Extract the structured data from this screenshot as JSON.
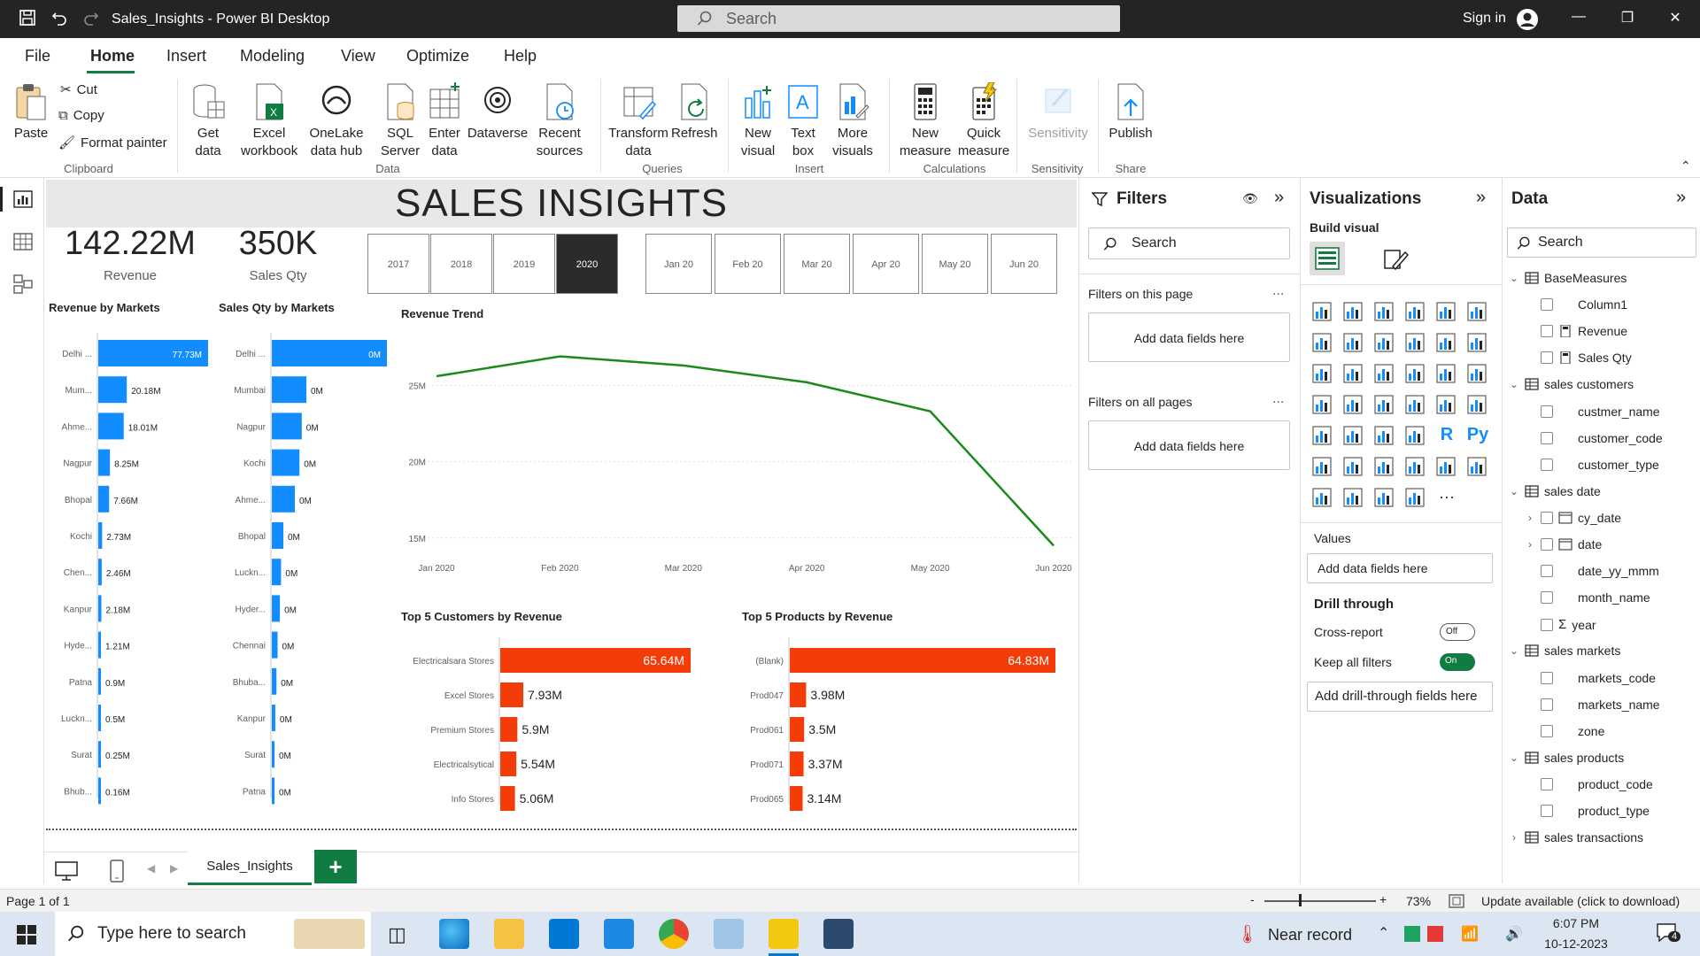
{
  "window": {
    "title": "Sales_Insights - Power BI Desktop",
    "search_placeholder": "Search",
    "sign_in": "Sign in"
  },
  "menu": [
    "File",
    "Home",
    "Insert",
    "Modeling",
    "View",
    "Optimize",
    "Help"
  ],
  "ribbon": {
    "paste": "Paste",
    "cut": "Cut",
    "copy": "Copy",
    "format_painter": "Format painter",
    "clipboard": "Clipboard",
    "get_data": "Get data",
    "excel": "Excel workbook",
    "onelake": "OneLake data hub",
    "sql": "SQL Server",
    "enter_data": "Enter data",
    "dataverse": "Dataverse",
    "recent": "Recent sources",
    "data_group": "Data",
    "transform": "Transform data",
    "refresh": "Refresh",
    "queries": "Queries",
    "new_visual": "New visual",
    "text_box": "Text box",
    "more_visuals": "More visuals",
    "insert": "Insert",
    "new_measure": "New measure",
    "quick_measure": "Quick measure",
    "calculations": "Calculations",
    "sensitivity": "Sensitivity",
    "sensitivity_group": "Sensitivity",
    "publish": "Publish",
    "share": "Share"
  },
  "report": {
    "title": "SALES INSIGHTS",
    "kpis": [
      {
        "value": "142.22M",
        "label": "Revenue"
      },
      {
        "value": "350K",
        "label": "Sales Qty"
      }
    ],
    "year_slicer": [
      "2017",
      "2018",
      "2019",
      "2020"
    ],
    "year_selected": "2020",
    "month_slicer": [
      "Jan 20",
      "Feb 20",
      "Mar 20",
      "Apr 20",
      "May 20",
      "Jun 20"
    ]
  },
  "chart_data": [
    {
      "type": "bar",
      "title": "Revenue by Markets",
      "categories": [
        "Delhi ...",
        "Mum...",
        "Ahme...",
        "Nagpur",
        "Bhopal",
        "Kochi",
        "Chen...",
        "Kanpur",
        "Hyde...",
        "Patna",
        "Luckn...",
        "Surat",
        "Bhub..."
      ],
      "values": [
        77.73,
        20.18,
        18.01,
        8.25,
        7.66,
        2.73,
        2.46,
        2.18,
        1.21,
        0.9,
        0.5,
        0.25,
        0.16
      ],
      "labels": [
        "77.73M",
        "20.18M",
        "18.01M",
        "8.25M",
        "7.66M",
        "2.73M",
        "2.46M",
        "2.18M",
        "1.21M",
        "0.9M",
        "0.5M",
        "0.25M",
        "0.16M"
      ],
      "color": "#118dff"
    },
    {
      "type": "bar",
      "title": "Sales Qty by Markets",
      "categories": [
        "Delhi ...",
        "Mumbai",
        "Nagpur",
        "Kochi",
        "Ahme...",
        "Bhopal",
        "Luckn...",
        "Hyder...",
        "Chennai",
        "Bhuba...",
        "Kanpur",
        "Surat",
        "Patna"
      ],
      "values": [
        100,
        30,
        26,
        24,
        20,
        10,
        8,
        7,
        5,
        4,
        3,
        2,
        1.5
      ],
      "labels": [
        "0M",
        "0M",
        "0M",
        "0M",
        "0M",
        "0M",
        "0M",
        "0M",
        "0M",
        "0M",
        "0M",
        "0M",
        "0M"
      ],
      "color": "#118dff"
    },
    {
      "type": "line",
      "title": "Revenue Trend",
      "x": [
        "Jan 2020",
        "Feb 2020",
        "Mar 2020",
        "Apr 2020",
        "May 2020",
        "Jun 2020"
      ],
      "values": [
        25.6,
        26.9,
        26.3,
        25.2,
        23.3,
        14.5
      ],
      "yticks": [
        "15M",
        "20M",
        "25M"
      ],
      "ylim": [
        14,
        28.5
      ],
      "color": "#1a8a1a"
    },
    {
      "type": "bar",
      "title": "Top 5 Customers by Revenue",
      "categories": [
        "Electricalsara Stores",
        "Excel Stores",
        "Premium Stores",
        "Electricalsytical",
        "Info Stores"
      ],
      "values": [
        65.64,
        7.93,
        5.9,
        5.54,
        5.06
      ],
      "labels": [
        "65.64M",
        "7.93M",
        "5.9M",
        "5.54M",
        "5.06M"
      ],
      "color": "#f43c09"
    },
    {
      "type": "bar",
      "title": "Top 5 Products by Revenue",
      "categories": [
        "(Blank)",
        "Prod047",
        "Prod061",
        "Prod071",
        "Prod065"
      ],
      "values": [
        64.83,
        3.98,
        3.5,
        3.37,
        3.14
      ],
      "labels": [
        "64.83M",
        "3.98M",
        "3.5M",
        "3.37M",
        "3.14M"
      ],
      "color": "#f43c09"
    }
  ],
  "filters": {
    "title": "Filters",
    "search": "Search",
    "on_page": "Filters on this page",
    "on_all": "Filters on all pages",
    "add": "Add data fields here",
    "more": "..."
  },
  "viz": {
    "title": "Visualizations",
    "build": "Build visual",
    "values": "Values",
    "add_values": "Add data fields here",
    "drill": "Drill through",
    "cross": "Cross-report",
    "cross_state": "Off",
    "keep": "Keep all filters",
    "keep_state": "On",
    "add_drill": "Add drill-through fields here",
    "more": "..."
  },
  "data_pane": {
    "title": "Data",
    "search": "Search",
    "tree": [
      {
        "label": "BaseMeasures",
        "kind": "table",
        "open": true
      },
      {
        "label": "Column1",
        "kind": "field"
      },
      {
        "label": "Revenue",
        "kind": "measure"
      },
      {
        "label": "Sales Qty",
        "kind": "measure"
      },
      {
        "label": "sales customers",
        "kind": "table",
        "open": true
      },
      {
        "label": "custmer_name",
        "kind": "field"
      },
      {
        "label": "customer_code",
        "kind": "field"
      },
      {
        "label": "customer_type",
        "kind": "field"
      },
      {
        "label": "sales date",
        "kind": "table",
        "open": true
      },
      {
        "label": "cy_date",
        "kind": "date"
      },
      {
        "label": "date",
        "kind": "date"
      },
      {
        "label": "date_yy_mmm",
        "kind": "field"
      },
      {
        "label": "month_name",
        "kind": "field"
      },
      {
        "label": "year",
        "kind": "sum"
      },
      {
        "label": "sales markets",
        "kind": "table",
        "open": true
      },
      {
        "label": "markets_code",
        "kind": "field"
      },
      {
        "label": "markets_name",
        "kind": "field"
      },
      {
        "label": "zone",
        "kind": "field"
      },
      {
        "label": "sales products",
        "kind": "table",
        "open": true
      },
      {
        "label": "product_code",
        "kind": "field"
      },
      {
        "label": "product_type",
        "kind": "field"
      },
      {
        "label": "sales transactions",
        "kind": "table",
        "open": false
      }
    ]
  },
  "tabs": {
    "page": "Sales_Insights",
    "add": "+"
  },
  "status": {
    "page": "Page 1 of 1",
    "zoom": "73%",
    "update": "Update available (click to download)",
    "minus": "-",
    "plus": "+"
  },
  "taskbar": {
    "search": "Type here to search",
    "weather": "Near record",
    "time": "6:07 PM",
    "date": "10-12-2023",
    "notif": "4"
  }
}
